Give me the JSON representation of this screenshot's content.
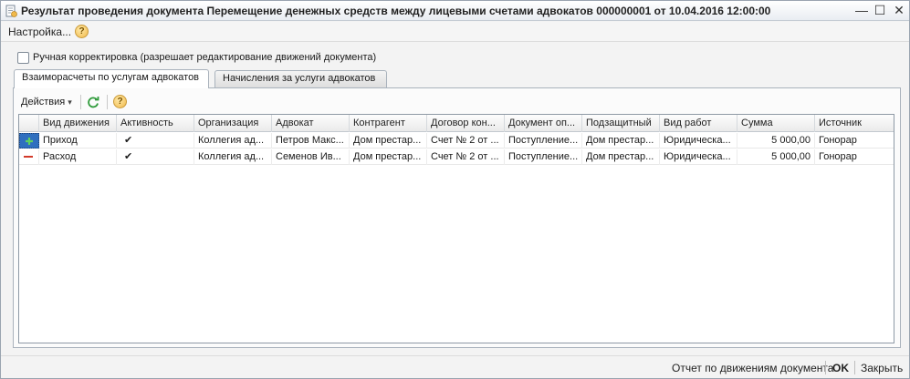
{
  "window": {
    "title": "Результат проведения документа Перемещение денежных средств между лицевыми счетами адвокатов 000000001 от 10.04.2016 12:00:00",
    "minimize_glyph": "—",
    "maximize_glyph": "☐",
    "close_glyph": "✕"
  },
  "menu": {
    "settings_label": "Настройка...",
    "help_glyph": "?"
  },
  "manual_correction": {
    "label": "Ручная корректировка (разрешает редактирование движений документа)",
    "checked": false
  },
  "tabs": [
    {
      "label": "Взаиморасчеты по услугам адвокатов",
      "active": true
    },
    {
      "label": "Начисления за услуги адвокатов",
      "active": false
    }
  ],
  "toolbar": {
    "actions_label": "Действия",
    "dropdown_glyph": "▾",
    "help_glyph": "?"
  },
  "grid": {
    "columns": [
      "Вид движения",
      "Активность",
      "Организация",
      "Адвокат",
      "Контрагент",
      "Договор кон...",
      "Документ оп...",
      "Подзащитный",
      "Вид работ",
      "Сумма",
      "Источник"
    ],
    "rows": [
      {
        "kind": "income",
        "cells": [
          "Приход",
          "✔",
          "Коллегия ад...",
          "Петров Макс...",
          "Дом престар...",
          "Счет № 2 от ...",
          "Поступление...",
          "Дом престар...",
          "Юридическа...",
          "5 000,00",
          "Гонорар"
        ]
      },
      {
        "kind": "expense",
        "cells": [
          "Расход",
          "✔",
          "Коллегия ад...",
          "Семенов Ив...",
          "Дом престар...",
          "Счет № 2 от ...",
          "Поступление...",
          "Дом престар...",
          "Юридическа...",
          "5 000,00",
          "Гонорар"
        ]
      }
    ]
  },
  "status": {
    "report_label": "Отчет по движениям документа",
    "ok_label": "OK",
    "close_label": "Закрыть"
  },
  "colors": {
    "income_mark": "#3a9a3a",
    "expense_mark": "#d23a2a",
    "selection": "#2f6fbf"
  }
}
